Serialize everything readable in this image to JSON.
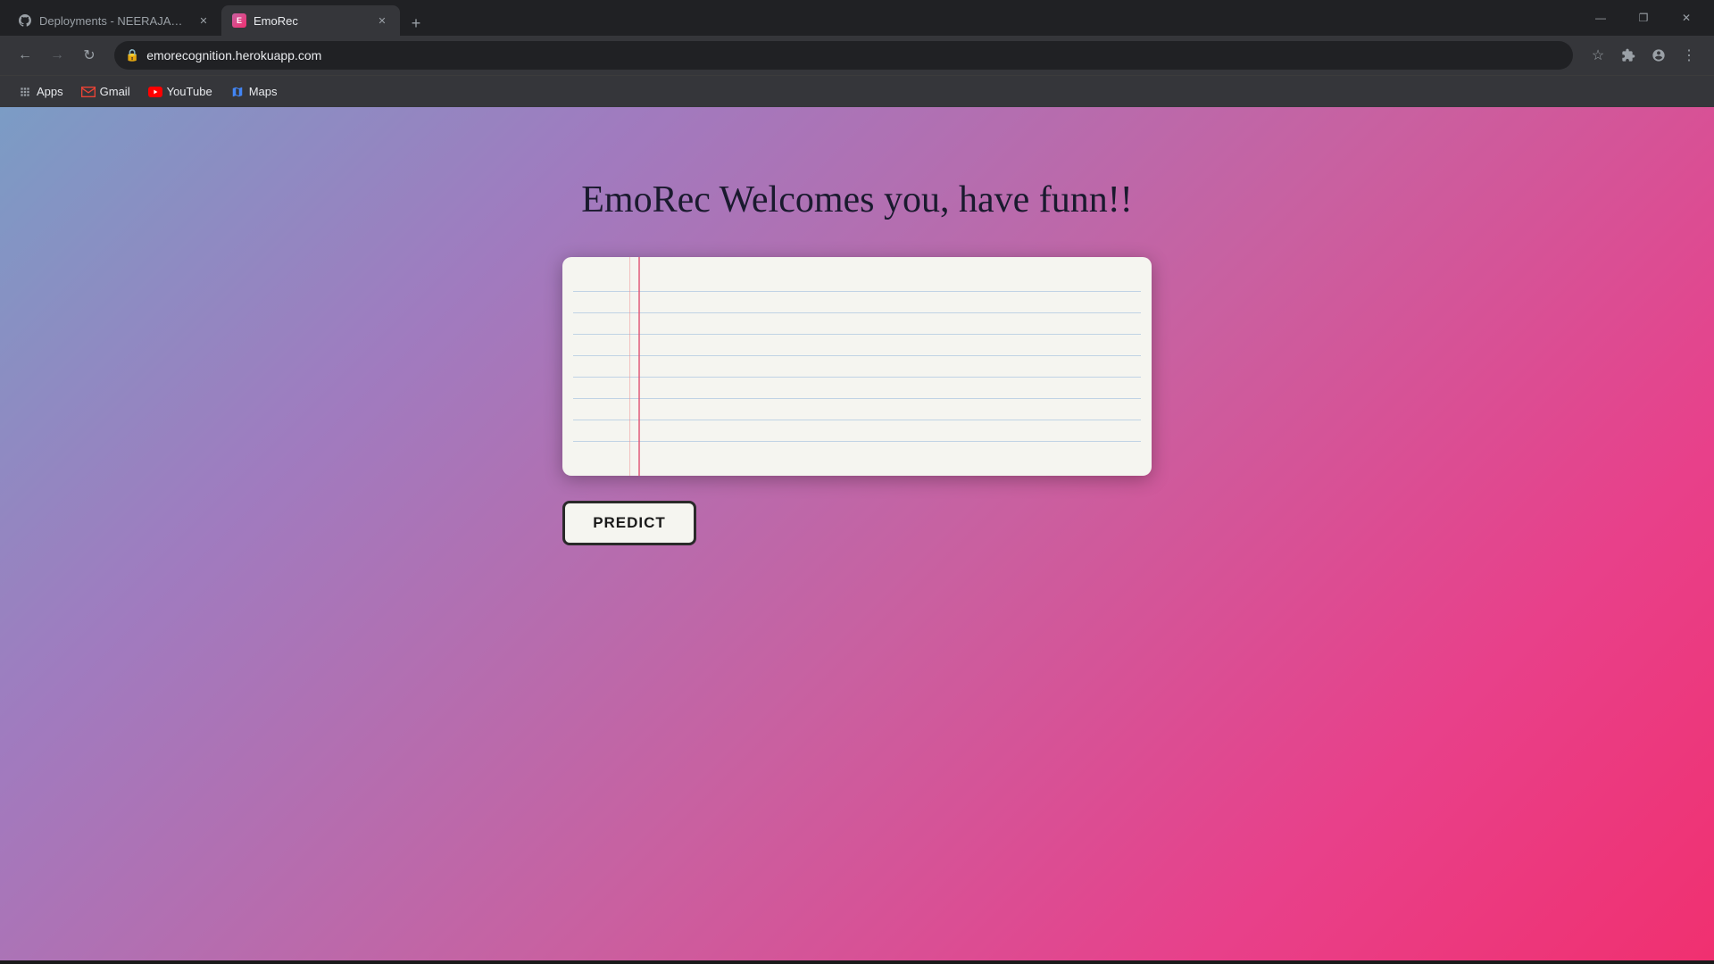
{
  "browser": {
    "tabs": [
      {
        "id": "deployments-tab",
        "title": "Deployments - NEERAJAP2001/E...",
        "favicon": "github",
        "active": false,
        "closeable": true
      },
      {
        "id": "emorec-tab",
        "title": "EmoRec",
        "favicon": "emorec",
        "active": true,
        "closeable": true
      }
    ],
    "new_tab_label": "+",
    "url": "emorecognition.herokuapp.com",
    "window_controls": {
      "minimize": "—",
      "maximize": "❐",
      "close": "✕"
    }
  },
  "nav": {
    "back_disabled": false,
    "forward_disabled": true,
    "reload": "↻",
    "lock_icon": "🔒"
  },
  "bookmarks": [
    {
      "id": "apps",
      "label": "Apps",
      "icon": "grid"
    },
    {
      "id": "gmail",
      "label": "Gmail",
      "icon": "gmail"
    },
    {
      "id": "youtube",
      "label": "YouTube",
      "icon": "youtube"
    },
    {
      "id": "maps",
      "label": "Maps",
      "icon": "maps"
    }
  ],
  "page": {
    "title": "EmoRec Welcomes you, have funn!!",
    "textarea_placeholder": "",
    "predict_button_label": "PREDICT"
  }
}
